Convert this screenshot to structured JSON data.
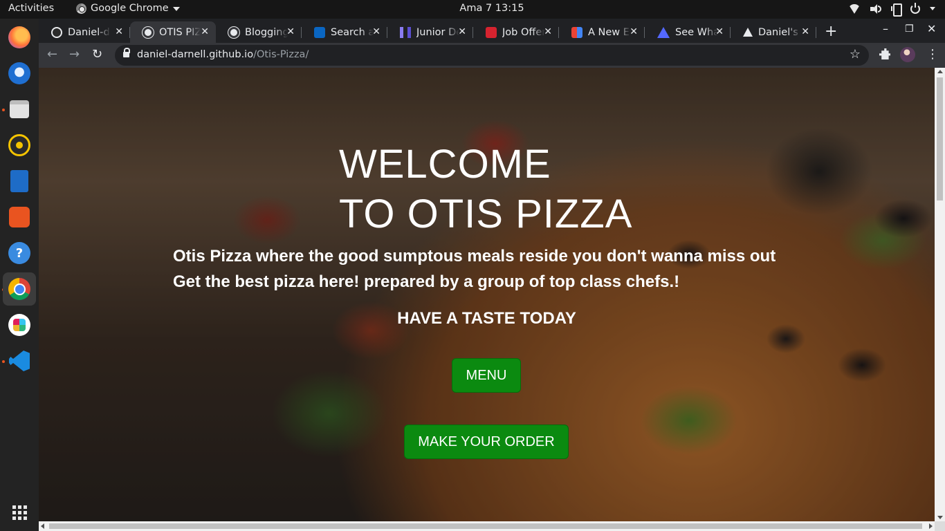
{
  "topbar": {
    "activities": "Activities",
    "app_name": "Google Chrome",
    "clock": "Ama 7  13:15"
  },
  "dock": {
    "apps": [
      "Firefox",
      "Thunderbird",
      "Files",
      "Rhythmbox",
      "LibreOffice Writer",
      "Ubuntu Software",
      "Help",
      "Google Chrome",
      "Slack",
      "Visual Studio Code",
      "Show Applications"
    ]
  },
  "browser": {
    "tabs": [
      {
        "label": "Daniel-darnell",
        "icon": "github-icon"
      },
      {
        "label": "OTIS PIZZA",
        "icon": "globe-icon",
        "active": true
      },
      {
        "label": "Blogging",
        "icon": "globe-icon"
      },
      {
        "label": "Search all",
        "icon": "linkedin-icon"
      },
      {
        "label": "Junior Dev",
        "icon": "junior-dev-icon"
      },
      {
        "label": "Job Offers",
        "icon": "w-icon"
      },
      {
        "label": "A New Ev",
        "icon": "gmail-icon"
      },
      {
        "label": "See What",
        "icon": "a-icon"
      },
      {
        "label": "Daniel's P",
        "icon": "a-icon"
      }
    ],
    "new_tab": "+",
    "url_host": "daniel-darnell.github.io",
    "url_path": "/Otis-Pizza/"
  },
  "hero": {
    "title_line1": "WELCOME",
    "title_line2": "TO OTIS PIZZA",
    "tagline_line1": "Otis Pizza where the good sumptous meals reside you don't wanna miss out",
    "tagline_line2": "Get the best pizza here! prepared by a group of top class chefs.!",
    "taste": "HAVE A TASTE TODAY",
    "menu_button": "MENU",
    "order_button": "MAKE YOUR ORDER"
  },
  "colors": {
    "button_green": "#0b8a10",
    "chrome_dark": "#202124",
    "chrome_toolbar": "#35363a"
  }
}
